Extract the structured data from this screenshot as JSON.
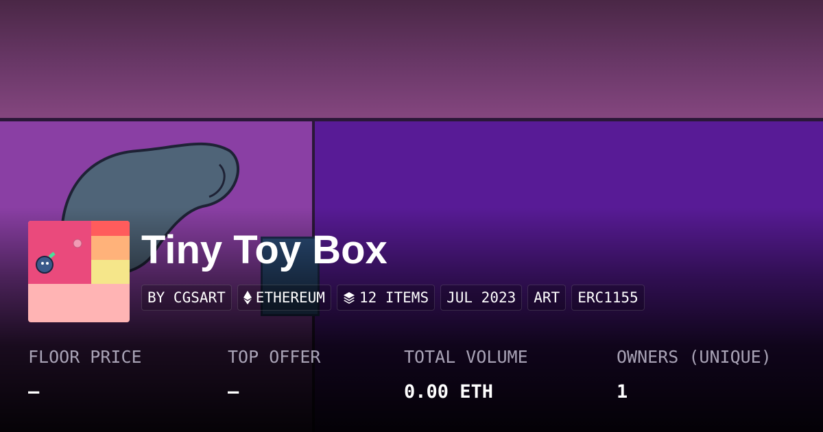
{
  "collection": {
    "title": "Tiny Toy Box",
    "chips": {
      "creator": "BY CGSART",
      "chain": "ETHEREUM",
      "items": "12 ITEMS",
      "date": "JUL 2023",
      "category": "ART",
      "standard": "ERC1155"
    }
  },
  "stats": {
    "floor_price": {
      "label": "FLOOR PRICE",
      "value": "–"
    },
    "top_offer": {
      "label": "TOP OFFER",
      "value": "–"
    },
    "total_volume": {
      "label": "TOTAL VOLUME",
      "value": "0.00 ETH"
    },
    "owners": {
      "label": "OWNERS (UNIQUE)",
      "value": "1"
    }
  },
  "icons": {
    "chain": "ethereum-icon",
    "items": "layers-icon"
  },
  "colors": {
    "banner_top": "#6a3868",
    "banner_left": "#8a3fa4",
    "banner_right": "#581b96",
    "thumb_pink": "#ea4a7c",
    "thumb_light": "#ffb4b4",
    "label_gray": "#a9a3b6"
  }
}
